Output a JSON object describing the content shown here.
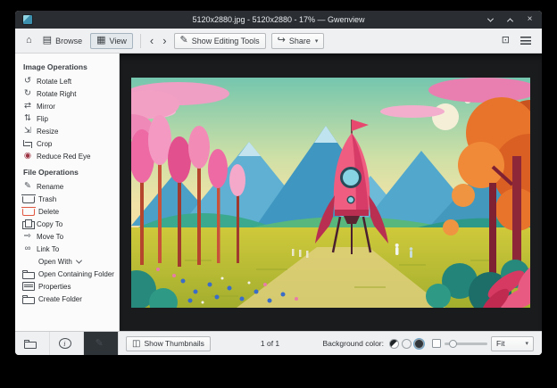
{
  "window": {
    "title": "5120x2880.jpg - 5120x2880 - 17% — Gwenview",
    "close_glyph": "×"
  },
  "toolbar": {
    "home_icon": "⌂",
    "browse": {
      "label": "Browse",
      "icon": "▤"
    },
    "view": {
      "label": "View",
      "icon": "▦"
    },
    "back_icon": "‹",
    "forward_icon": "›",
    "editing_tools": {
      "label": "Show Editing Tools",
      "icon": "✎"
    },
    "share": {
      "label": "Share",
      "icon": "↪",
      "chevron": "▾"
    },
    "fullscreen_icon": "⊡"
  },
  "sidebar": {
    "sections": [
      {
        "title": "Image Operations",
        "items": [
          {
            "name": "rotate-left",
            "label": "Rotate Left",
            "icon": "↺"
          },
          {
            "name": "rotate-right",
            "label": "Rotate Right",
            "icon": "↻"
          },
          {
            "name": "mirror",
            "label": "Mirror",
            "icon": "⇄"
          },
          {
            "name": "flip",
            "label": "Flip",
            "icon": "⇅"
          },
          {
            "name": "resize",
            "label": "Resize",
            "icon": "⇲"
          },
          {
            "name": "crop",
            "label": "Crop",
            "icon_shape": "crop"
          },
          {
            "name": "reduce-red-eye",
            "label": "Reduce Red Eye",
            "icon": "◉",
            "icon_color": "#9b3342"
          }
        ]
      },
      {
        "title": "File Operations",
        "items": [
          {
            "name": "rename",
            "label": "Rename",
            "icon": "✎"
          },
          {
            "name": "trash",
            "label": "Trash",
            "icon_shape": "trash"
          },
          {
            "name": "delete",
            "label": "Delete",
            "icon_shape": "trash",
            "icon_color": "#e0563f"
          },
          {
            "name": "copy-to",
            "label": "Copy To",
            "icon_shape": "copy"
          },
          {
            "name": "move-to",
            "label": "Move To",
            "icon": "⇨"
          },
          {
            "name": "link-to",
            "label": "Link To",
            "icon": "∞"
          },
          {
            "name": "open-with",
            "label": "Open With",
            "indent": true,
            "chevron": true
          },
          {
            "name": "open-containing-folder",
            "label": "Open Containing Folder",
            "icon_shape": "folder"
          },
          {
            "name": "properties",
            "label": "Properties",
            "icon_shape": "doc"
          },
          {
            "name": "create-folder",
            "label": "Create Folder",
            "icon_shape": "folder"
          }
        ]
      }
    ],
    "tabs": [
      {
        "name": "sidebar-tab-folders",
        "icon_name": "folder-icon",
        "icon_shape": "folder"
      },
      {
        "name": "sidebar-tab-information",
        "icon_name": "info-icon",
        "icon_shape": "info",
        "glyph": "i"
      },
      {
        "name": "sidebar-tab-operations",
        "icon_name": "pencil-icon",
        "icon": "✎",
        "active": true
      }
    ]
  },
  "statusbar": {
    "show_thumbnails": {
      "label": "Show Thumbnails",
      "icon": "◫"
    },
    "counter": "1 of 1",
    "background_color_label": "Background color:",
    "swatches": [
      {
        "name": "background-swatch-auto",
        "split": true
      },
      {
        "name": "background-swatch-light",
        "color": "#eff0f1"
      },
      {
        "name": "background-swatch-dark",
        "color": "#31363b",
        "selected": true
      }
    ],
    "zoom_mode": "Fit",
    "chevron": "▾"
  }
}
